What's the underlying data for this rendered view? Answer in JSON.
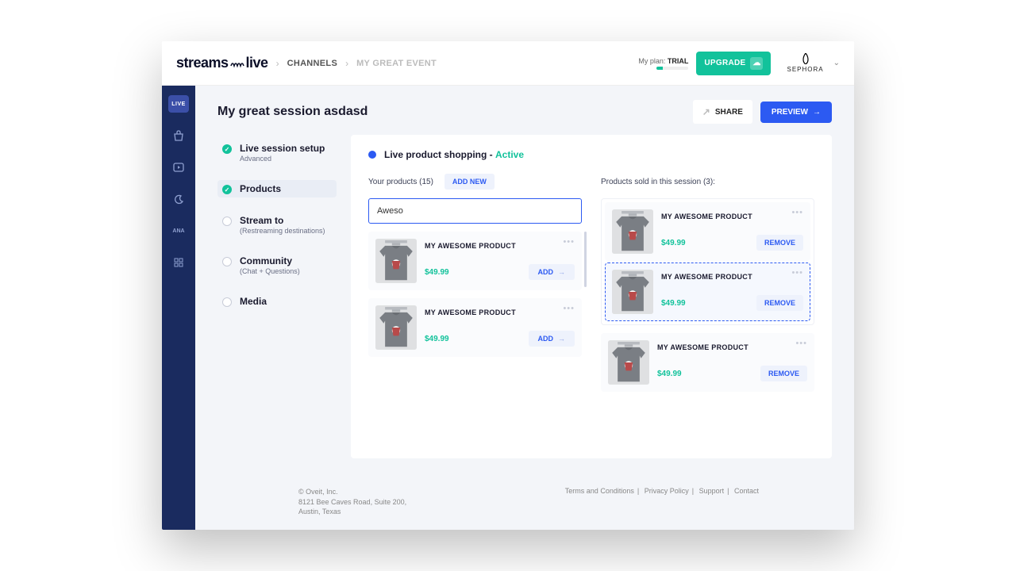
{
  "brand": {
    "name": "streams",
    "name_suffix": "live"
  },
  "breadcrumb": {
    "channels": "CHANNELS",
    "event": "MY GREAT EVENT"
  },
  "plan": {
    "label": "My plan:",
    "value": "TRIAL"
  },
  "upgrade_label": "UPGRADE",
  "org": {
    "name": "SEPHORA"
  },
  "page": {
    "title": "My great session asdasd",
    "share": "SHARE",
    "preview": "PREVIEW"
  },
  "sidebar": {
    "live": "LIVE"
  },
  "steps": [
    {
      "label": "Live session setup",
      "sub": "Advanced",
      "done": true
    },
    {
      "label": "Products",
      "sub": "",
      "done": true,
      "active": true
    },
    {
      "label": "Stream to",
      "sub": "(Restreaming destinations)",
      "done": false
    },
    {
      "label": "Community",
      "sub": "(Chat + Questions)",
      "done": false
    },
    {
      "label": "Media",
      "sub": "",
      "done": false
    }
  ],
  "panel": {
    "title_prefix": "Live product shopping - ",
    "title_status": "Active",
    "your_products_label": "Your products (15)",
    "add_new": "ADD NEW",
    "search_value": "Aweso",
    "sold_label": "Products sold in this session (3):"
  },
  "products_left": [
    {
      "name": "MY AWESOME PRODUCT",
      "price": "$49.99",
      "action": "ADD"
    },
    {
      "name": "MY AWESOME PRODUCT",
      "price": "$49.99",
      "action": "ADD"
    }
  ],
  "products_sold_group": [
    {
      "name": "MY AWESOME PRODUCT",
      "price": "$49.99",
      "action": "REMOVE"
    },
    {
      "name": "MY AWESOME PRODUCT",
      "price": "$49.99",
      "action": "REMOVE",
      "highlighted": true
    }
  ],
  "products_sold_rest": [
    {
      "name": "MY AWESOME PRODUCT",
      "price": "$49.99",
      "action": "REMOVE"
    }
  ],
  "footer": {
    "company": "© Oveit, Inc.",
    "address1": "8121 Bee Caves Road, Suite 200,",
    "address2": "Austin, Texas",
    "links": [
      "Terms and Conditions",
      "Privacy Policy",
      "Support",
      "Contact"
    ]
  }
}
